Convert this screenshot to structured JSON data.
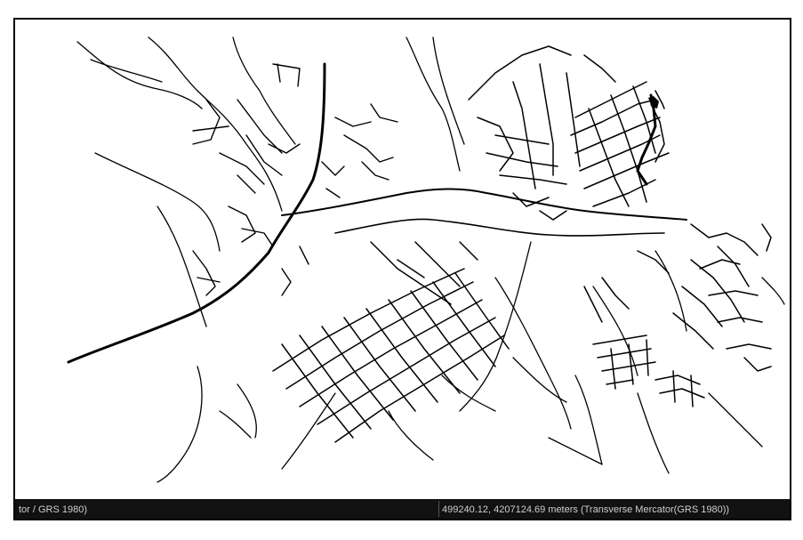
{
  "status_bar": {
    "left_text": "tor / GRS 1980)",
    "right_text": "499240.12, 4207124.69 meters (Transverse Mercator(GRS 1980))"
  },
  "map": {
    "feature_type": "road network",
    "line_color": "#000000",
    "background_color": "#ffffff"
  }
}
